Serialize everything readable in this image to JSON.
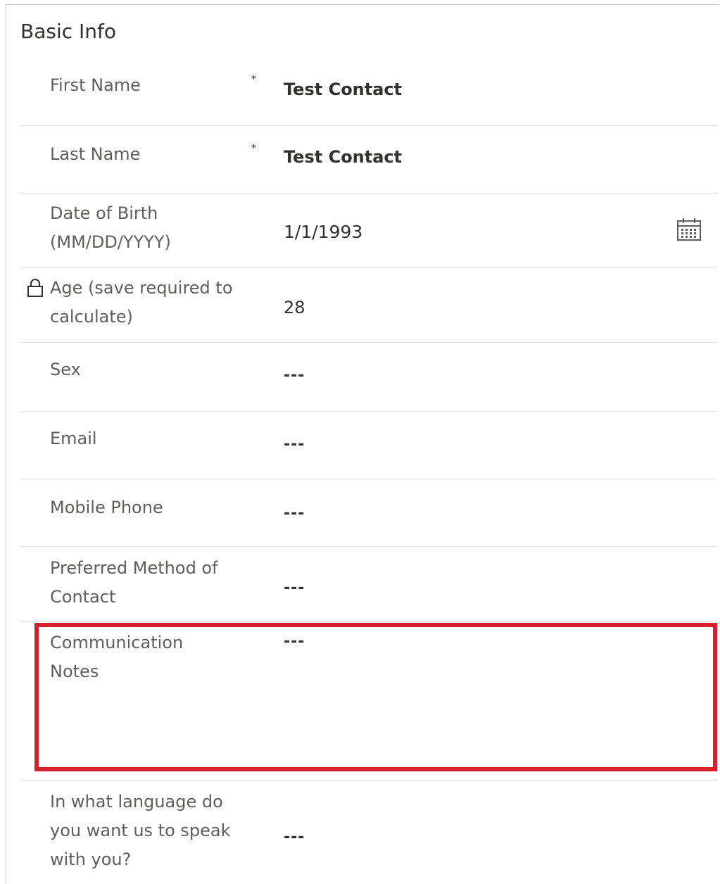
{
  "section": {
    "title": "Basic Info"
  },
  "fields": [
    {
      "label": "First Name",
      "required_marker": "*",
      "value": "Test Contact"
    },
    {
      "label": "Last Name",
      "required_marker": "*",
      "value": "Test Contact"
    },
    {
      "label_line1": "Date of Birth",
      "label_line2": "(MM/DD/YYYY)",
      "value": "1/1/1993"
    },
    {
      "label_line1": "Age (save required to",
      "label_line2": "calculate)",
      "value": "28"
    },
    {
      "label": "Sex",
      "value": "---"
    },
    {
      "label": "Email",
      "value": "---"
    },
    {
      "label": "Mobile Phone",
      "value": "---"
    },
    {
      "label_line1": "Preferred Method of",
      "label_line2": "Contact",
      "value": "---"
    },
    {
      "label_line1": "Communication",
      "label_line2": "Notes",
      "value": "---"
    },
    {
      "label_line1": "In what language do",
      "label_line2": "you want us to speak",
      "label_line3": "with you?",
      "value": "---"
    }
  ],
  "icons": {
    "lock": "lock-icon",
    "calendar": "calendar-icon"
  },
  "colors": {
    "highlight": "#d6202c",
    "divider": "#e1dfdd",
    "label": "#605e5c",
    "value": "#323130"
  }
}
